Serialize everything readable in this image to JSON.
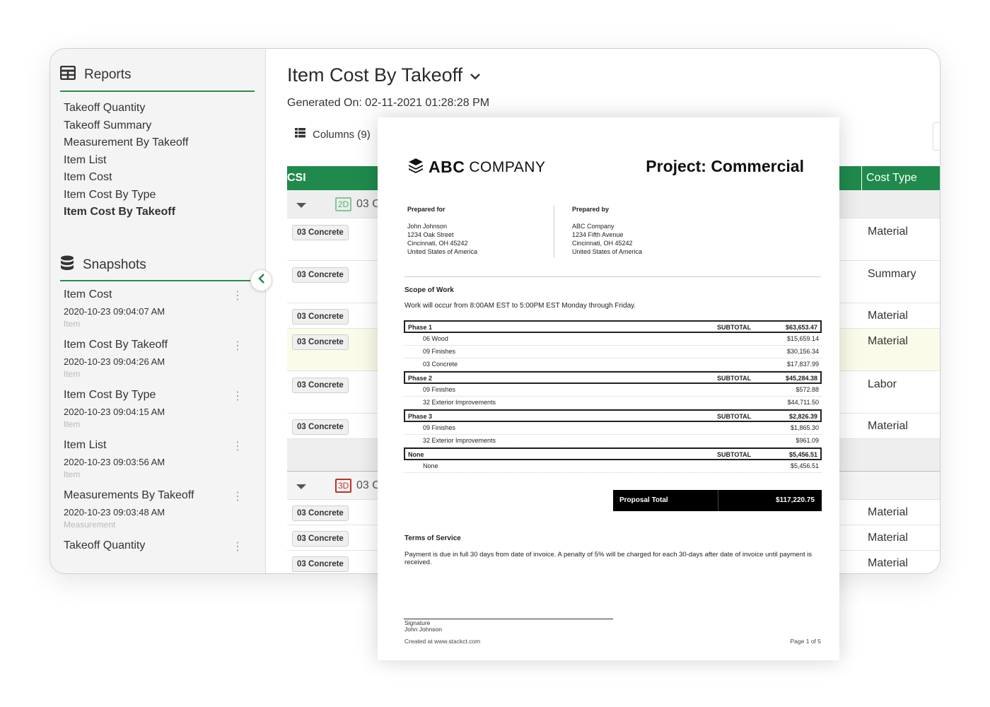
{
  "sidebar": {
    "reports_title": "Reports",
    "reports": [
      "Takeoff Quantity",
      "Takeoff Summary",
      "Measurement By Takeoff",
      "Item List",
      "Item Cost",
      "Item Cost By Type",
      "Item Cost By Takeoff"
    ],
    "snapshots_title": "Snapshots",
    "snapshots": [
      {
        "title": "Item Cost",
        "date": "2020-10-23 09:04:07 AM",
        "category": "Item"
      },
      {
        "title": "Item Cost By Takeoff",
        "date": "2020-10-23 09:04:26 AM",
        "category": "Item"
      },
      {
        "title": "Item Cost By Type",
        "date": "2020-10-23 09:04:15 AM",
        "category": "Item"
      },
      {
        "title": "Item List",
        "date": "2020-10-23 09:03:56 AM",
        "category": "Item"
      },
      {
        "title": "Measurements By Takeoff",
        "date": "2020-10-23 09:03:48 AM",
        "category": "Measurement"
      },
      {
        "title": "Takeoff Quantity",
        "date": "",
        "category": ""
      }
    ],
    "kebab": "⋮"
  },
  "main": {
    "title": "Item Cost By Takeoff",
    "generated": "Generated On: 02-11-2021 01:28:28 PM",
    "columns_label": "Columns (9)",
    "grid_header": {
      "csi": "CSI",
      "cost_type": "Cost Type"
    },
    "group1": {
      "badge": "2D",
      "num": "03 C"
    },
    "group2": {
      "badge": "3D",
      "num": "03 C"
    },
    "tags": [
      "03 Concrete",
      "03 Concrete",
      "03 Concrete",
      "03 Concrete",
      "03 Concrete",
      "03 Concrete",
      "03 Concrete",
      "03 Concrete",
      "03 Concrete"
    ],
    "cost_types": [
      "Material",
      "Summary",
      "Material",
      "Material",
      "Labor",
      "Material",
      "Material",
      "Material",
      "Material"
    ]
  },
  "doc": {
    "logo_bold": "ABC",
    "logo_light": "COMPANY",
    "project": "Project: Commercial",
    "prepared_for": {
      "heading": "Prepared for",
      "name": "John Johnson",
      "street": "1234 Oak Street",
      "city": "Cincinnati, OH 45242",
      "country": "United States of America"
    },
    "prepared_by": {
      "heading": "Prepared by",
      "name": "ABC Company",
      "street": "1234 Fifth Avenue",
      "city": "Cincinnati, OH 45242",
      "country": "United States of America"
    },
    "scope_heading": "Scope of Work",
    "scope_text": "Work will occur from 8:00AM EST to 5:00PM EST Monday through Friday.",
    "subtotal_label": "SUBTOTAL",
    "rows": [
      {
        "type": "phase",
        "name": "Phase 1",
        "value": "$63,653.47"
      },
      {
        "type": "item",
        "name": "06 Wood",
        "value": "$15,659.14"
      },
      {
        "type": "item",
        "name": "09 Finishes",
        "value": "$30,156.34"
      },
      {
        "type": "item",
        "name": "03 Concrete",
        "value": "$17,837.99"
      },
      {
        "type": "phase",
        "name": "Phase 2",
        "value": "$45,284.38"
      },
      {
        "type": "item",
        "name": "09 Finishes",
        "value": "$572.88"
      },
      {
        "type": "item",
        "name": "32 Exterior Improvements",
        "value": "$44,711.50"
      },
      {
        "type": "phase",
        "name": "Phase 3",
        "value": "$2,826.39"
      },
      {
        "type": "item",
        "name": "09 Finishes",
        "value": "$1,865.30"
      },
      {
        "type": "item",
        "name": "32 Exterior Improvements",
        "value": "$961.09"
      },
      {
        "type": "phase",
        "name": "None",
        "value": "$5,456.51"
      },
      {
        "type": "item",
        "name": "None",
        "value": "$5,456.51"
      }
    ],
    "total_label": "Proposal Total",
    "total_value": "$117,220.75",
    "tos_heading": "Terms of Service",
    "tos_text": "Payment is due in full 30 days from date of invoice. A penalty of 5% will be charged for each 30-days after date of invoice until payment is received.",
    "signature_label": "Signature",
    "signature_name": "John Johnson",
    "created": "Created at www.stackct.com",
    "page": "Page 1 of 5"
  },
  "colors": {
    "accent": "#1f8a4c",
    "highlight_row": "#fbfbea",
    "badge_2d": "#4caf6a",
    "badge_3d": "#c0302a"
  }
}
